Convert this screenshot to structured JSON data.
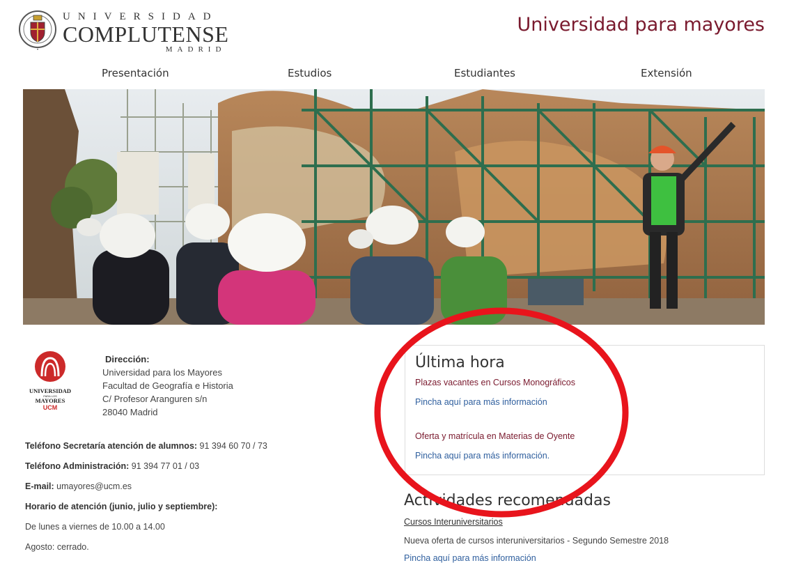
{
  "header": {
    "logo": {
      "line1": "UNIVERSIDAD",
      "line2": "COMPLUTENSE",
      "line3": "MADRID"
    },
    "site_title": "Universidad para mayores"
  },
  "nav": {
    "items": [
      {
        "label": "Presentación"
      },
      {
        "label": "Estudios"
      },
      {
        "label": "Estudiantes"
      },
      {
        "label": "Extensión"
      }
    ]
  },
  "hero": {
    "icon": "photo-archaeological-site-visit"
  },
  "um_logo": {
    "line1": "UNIVERSIDAD",
    "line2": "PARA LOS",
    "line3": "MAYORES",
    "line4": "UCM"
  },
  "address": {
    "heading": "Dirección:",
    "lines": [
      "Universidad para los Mayores",
      "Facultad de Geografía e Historia",
      "C/ Profesor Aranguren s/n",
      "28040 Madrid"
    ]
  },
  "contact": {
    "phone_students_label": "Teléfono Secretaría atención de alumnos:",
    "phone_students_value": " 91 394 60 70 / 73",
    "phone_admin_label": "Teléfono Administración:",
    "phone_admin_value": " 91 394 77 01 / 03",
    "email_label": "E-mail:",
    "email_value": " umayores@ucm.es",
    "hours_label": "Horario de atención (junio, julio y septiembre):",
    "hours_value": "De lunes a viernes de 10.00 a 14.00",
    "august": "Agosto: cerrado."
  },
  "news": {
    "title": "Última hora",
    "items": [
      {
        "headline": "Plazas vacantes en Cursos Monográficos",
        "link": "Pincha aquí para más información"
      },
      {
        "headline": "Oferta y matrícula en Materias de Oyente",
        "link": "Pincha aquí para más información."
      }
    ]
  },
  "activities": {
    "title": "Actividades recomendadas",
    "subtitle": "Cursos Interuniversitarios",
    "text": "Nueva oferta de cursos interuniversitarios - Segundo Semestre 2018",
    "link": "Pincha aquí para más información"
  },
  "colors": {
    "brand": "#7a1a2e",
    "link": "#2f5f9e",
    "annotation": "#e8141c"
  }
}
